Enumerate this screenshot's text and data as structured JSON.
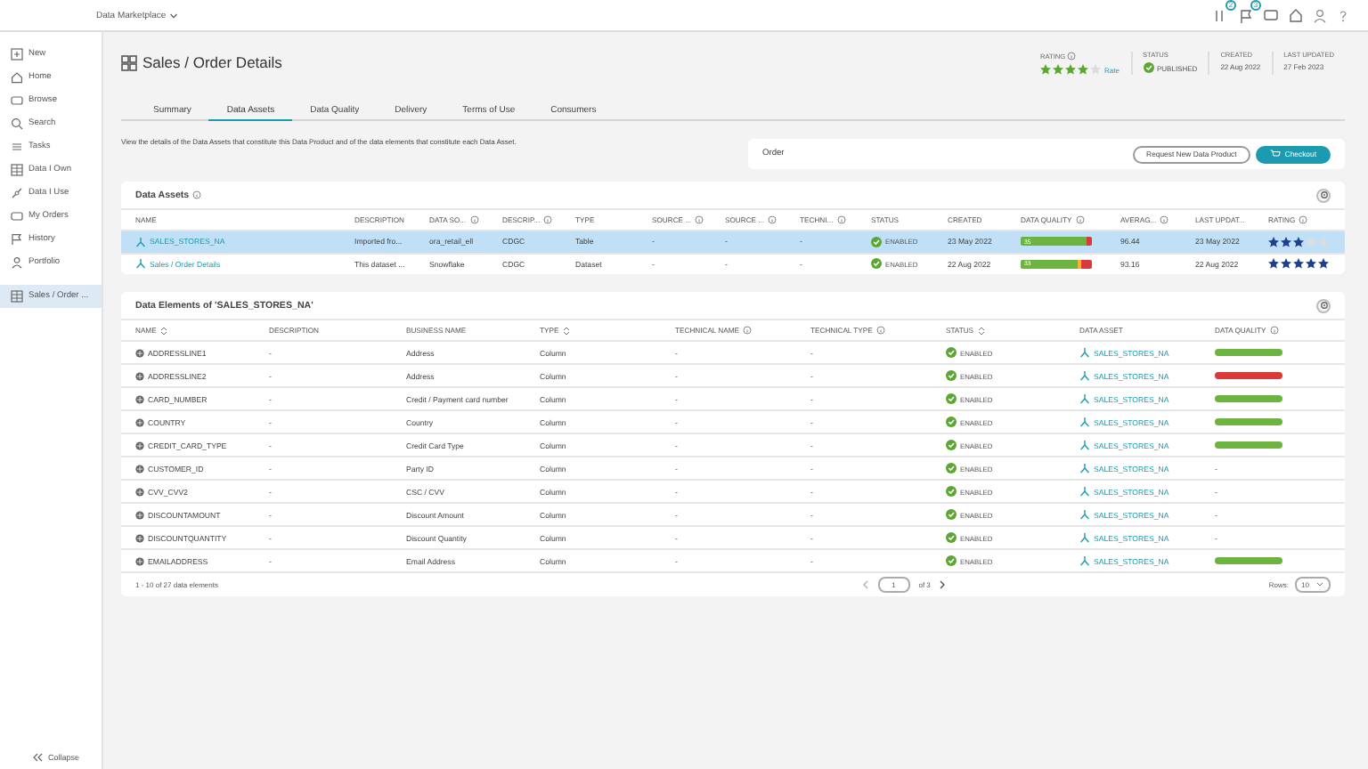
{
  "topbar": {
    "app_name": "Data Marketplace",
    "badges": [
      "2",
      "3"
    ]
  },
  "sidebar": {
    "items": [
      {
        "label": "New",
        "selected": false
      },
      {
        "label": "Home",
        "selected": false
      },
      {
        "label": "Browse",
        "selected": false
      },
      {
        "label": "Search",
        "selected": false
      },
      {
        "label": "Tasks",
        "selected": false
      },
      {
        "label": "Data I Own",
        "selected": false
      },
      {
        "label": "Data I Use",
        "selected": false
      },
      {
        "label": "My Orders",
        "selected": false
      },
      {
        "label": "History",
        "selected": false
      },
      {
        "label": "Portfolio",
        "selected": false
      },
      {
        "label": "Sales / Order ...",
        "selected": true
      }
    ],
    "collapse": "Collapse"
  },
  "header": {
    "title": "Sales / Order Details",
    "rating_label": "RATING",
    "stars": 4,
    "rate": "Rate",
    "status_label": "STATUS",
    "status": "PUBLISHED",
    "created_label": "CREATED",
    "created": "22 Aug 2022",
    "updated_label": "LAST UPDATED",
    "updated": "27 Feb 2023"
  },
  "tabs": [
    {
      "label": "Summary",
      "selected": false
    },
    {
      "label": "Data Assets",
      "selected": true
    },
    {
      "label": "Data Quality",
      "selected": false
    },
    {
      "label": "Delivery",
      "selected": false
    },
    {
      "label": "Terms of Use",
      "selected": false
    },
    {
      "label": "Consumers",
      "selected": false
    }
  ],
  "description": "View the details of the Data Assets that constitute this Data Product and of the data elements that constitute each Data Asset.",
  "order": {
    "title": "Order",
    "request": "Request New Data Product",
    "checkout": "Checkout"
  },
  "assets": {
    "title": "Data Assets",
    "columns": [
      {
        "label": "NAME",
        "kind": "plain"
      },
      {
        "label": "DESCRIPTION",
        "kind": "plain"
      },
      {
        "label": "DATA SO...",
        "kind": "info"
      },
      {
        "label": "DESCRIP...",
        "kind": "info"
      },
      {
        "label": "TYPE",
        "kind": "plain"
      },
      {
        "label": "SOURCE ...",
        "kind": "info"
      },
      {
        "label": "SOURCE ...",
        "kind": "info"
      },
      {
        "label": "TECHNI...",
        "kind": "info"
      },
      {
        "label": "STATUS",
        "kind": "plain"
      },
      {
        "label": "CREATED",
        "kind": "plain"
      },
      {
        "label": "DATA QUALITY",
        "kind": "info"
      },
      {
        "label": "AVERAG...",
        "kind": "info"
      },
      {
        "label": "LAST UPDAT...",
        "kind": "plain"
      },
      {
        "label": "RATING",
        "kind": "info"
      }
    ],
    "rows": [
      {
        "selected": true,
        "name": "SALES_STORES_NA",
        "description": "Imported fro...",
        "data_source": "ora_retail_ell",
        "descrip": "CDGC",
        "type": "Table",
        "source_1": "-",
        "source_2": "-",
        "technical": "-",
        "status": "ENABLED",
        "created": "23 May 2022",
        "quality": [
          {
            "color": "#6cb33f",
            "level": 0.92,
            "label": "35"
          },
          {
            "color": "#d93a3a",
            "level": 0.08
          }
        ],
        "average": "96.44",
        "updated": "23 May 2022",
        "stars": 3
      },
      {
        "selected": false,
        "name": "Sales / Order Details",
        "description": "This dataset ...",
        "data_source": "Snowflake",
        "descrip": "CDGC",
        "type": "Dataset",
        "source_1": "-",
        "source_2": "-",
        "technical": "-",
        "status": "ENABLED",
        "created": "22 Aug 2022",
        "quality": [
          {
            "color": "#6cb33f",
            "level": 0.8,
            "label": "33"
          },
          {
            "color": "#f2b530",
            "level": 0.06
          },
          {
            "color": "#d93a3a",
            "level": 0.14
          }
        ],
        "average": "93.16",
        "updated": "22 Aug 2022",
        "stars": 5
      }
    ]
  },
  "elements": {
    "title": "Data Elements of 'SALES_STORES_NA'",
    "columns": [
      {
        "label": "NAME",
        "kind": "sortable"
      },
      {
        "label": "DESCRIPTION",
        "kind": "plain"
      },
      {
        "label": "BUSINESS NAME",
        "kind": "plain"
      },
      {
        "label": "TYPE",
        "kind": "sortable"
      },
      {
        "label": "TECHNICAL NAME",
        "kind": "info"
      },
      {
        "label": "TECHNICAL TYPE",
        "kind": "info"
      },
      {
        "label": "STATUS",
        "kind": "sortable"
      },
      {
        "label": "DATA ASSET",
        "kind": "plain"
      },
      {
        "label": "DATA QUALITY",
        "kind": "info"
      }
    ],
    "rows": [
      {
        "name": "ADDRESSLINE1",
        "description": "-",
        "business_name": "Address",
        "type": "Column",
        "technical_name": "-",
        "technical_type": "-",
        "status": "ENABLED",
        "asset": "SALES_STORES_NA",
        "quality": {
          "color": "#6cb33f"
        }
      },
      {
        "name": "ADDRESSLINE2",
        "description": "-",
        "business_name": "Address",
        "type": "Column",
        "technical_name": "-",
        "technical_type": "-",
        "status": "ENABLED",
        "asset": "SALES_STORES_NA",
        "quality": {
          "color": "#d93a3a"
        }
      },
      {
        "name": "CARD_NUMBER",
        "description": "-",
        "business_name": "Credit / Payment card number",
        "type": "Column",
        "technical_name": "-",
        "technical_type": "-",
        "status": "ENABLED",
        "asset": "SALES_STORES_NA",
        "quality": {
          "color": "#6cb33f"
        }
      },
      {
        "name": "COUNTRY",
        "description": "-",
        "business_name": "Country",
        "type": "Column",
        "technical_name": "-",
        "technical_type": "-",
        "status": "ENABLED",
        "asset": "SALES_STORES_NA",
        "quality": {
          "color": "#6cb33f"
        }
      },
      {
        "name": "CREDIT_CARD_TYPE",
        "description": "-",
        "business_name": "Credit Card Type",
        "type": "Column",
        "technical_name": "-",
        "technical_type": "-",
        "status": "ENABLED",
        "asset": "SALES_STORES_NA",
        "quality": {
          "color": "#6cb33f"
        }
      },
      {
        "name": "CUSTOMER_ID",
        "description": "-",
        "business_name": "Party ID",
        "type": "Column",
        "technical_name": "-",
        "technical_type": "-",
        "status": "ENABLED",
        "asset": "SALES_STORES_NA",
        "quality": {
          "text": "-"
        }
      },
      {
        "name": "CVV_CVV2",
        "description": "-",
        "business_name": "CSC / CVV",
        "type": "Column",
        "technical_name": "-",
        "technical_type": "-",
        "status": "ENABLED",
        "asset": "SALES_STORES_NA",
        "quality": {
          "text": "-"
        }
      },
      {
        "name": "DISCOUNTAMOUNT",
        "description": "-",
        "business_name": "Discount Amount",
        "type": "Column",
        "technical_name": "-",
        "technical_type": "-",
        "status": "ENABLED",
        "asset": "SALES_STORES_NA",
        "quality": {
          "text": "-"
        }
      },
      {
        "name": "DISCOUNTQUANTITY",
        "description": "-",
        "business_name": "Discount Quantity",
        "type": "Column",
        "technical_name": "-",
        "technical_type": "-",
        "status": "ENABLED",
        "asset": "SALES_STORES_NA",
        "quality": {
          "text": "-"
        }
      },
      {
        "name": "EMAILADDRESS",
        "description": "-",
        "business_name": "Email Address",
        "type": "Column",
        "technical_name": "-",
        "technical_type": "-",
        "status": "ENABLED",
        "asset": "SALES_STORES_NA",
        "quality": {
          "color": "#6cb33f"
        }
      }
    ],
    "summary": "1 - 10 of 27 data elements",
    "page": "1",
    "of_pages": "of 3",
    "rows_label": "Rows:",
    "rows_value": "10"
  }
}
